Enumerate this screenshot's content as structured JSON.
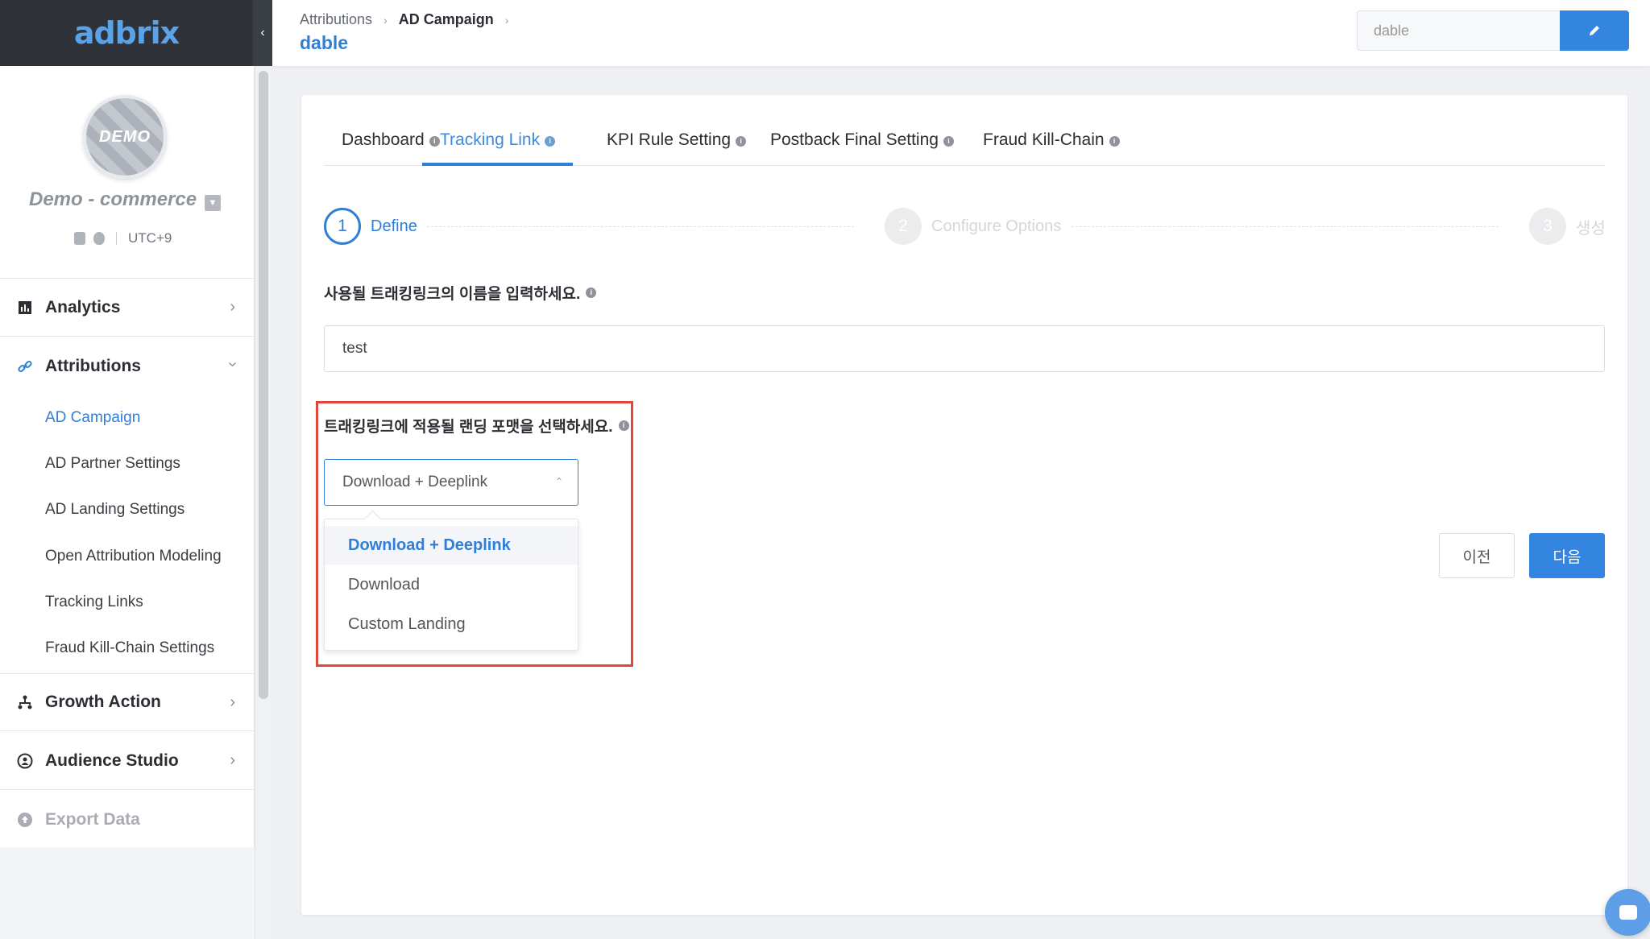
{
  "brand": {
    "logo_text": "adbrix",
    "accent_color": "#2f7fd6",
    "highlight_color": "#e0473a"
  },
  "sidebar": {
    "collapse_icon": "chevron-left-icon",
    "profile": {
      "avatar_text": "DEMO",
      "app_name": "Demo - commerce",
      "timezone": "UTC+9",
      "platforms": [
        "android-icon",
        "apple-icon"
      ]
    },
    "sections": [
      {
        "label": "Analytics",
        "icon": "bar-chart-icon",
        "expanded": false
      },
      {
        "label": "Attributions",
        "icon": "link-icon",
        "expanded": true
      },
      {
        "label": "Growth Action",
        "icon": "flow-icon",
        "expanded": false
      },
      {
        "label": "Audience Studio",
        "icon": "audience-icon",
        "expanded": false
      },
      {
        "label": "Export Data",
        "icon": "upload-icon",
        "disabled": true
      }
    ],
    "attribution_items": [
      {
        "label": "AD Campaign",
        "active": true
      },
      {
        "label": "AD Partner Settings"
      },
      {
        "label": "AD Landing Settings"
      },
      {
        "label": "Open Attribution Modeling"
      },
      {
        "label": "Tracking Links"
      },
      {
        "label": "Fraud Kill-Chain Settings"
      }
    ]
  },
  "header": {
    "breadcrumbs": [
      "Attributions",
      "AD Campaign"
    ],
    "title": "dable",
    "input_value": "dable",
    "edit_icon": "pencil-icon"
  },
  "tabs": [
    {
      "label": "Dashboard"
    },
    {
      "label": "Tracking Link",
      "active": true
    },
    {
      "label": "KPI Rule Setting"
    },
    {
      "label": "Postback Final Setting"
    },
    {
      "label": "Fraud Kill-Chain"
    }
  ],
  "steps": [
    {
      "number": "1",
      "label": "Define",
      "active": true
    },
    {
      "number": "2",
      "label": "Configure Options"
    },
    {
      "number": "3",
      "label": "생성"
    }
  ],
  "form": {
    "name_question": "사용될 트래킹링크의 이름을 입력하세요.",
    "name_value": "test",
    "landing_question": "트래킹링크에 적용될 랜딩 포맷을 선택하세요.",
    "landing_selected": "Download + Deeplink",
    "landing_options": [
      "Download + Deeplink",
      "Download",
      "Custom Landing"
    ]
  },
  "buttons": {
    "prev": "이전",
    "next": "다음"
  },
  "chat_icon": "chat-icon"
}
